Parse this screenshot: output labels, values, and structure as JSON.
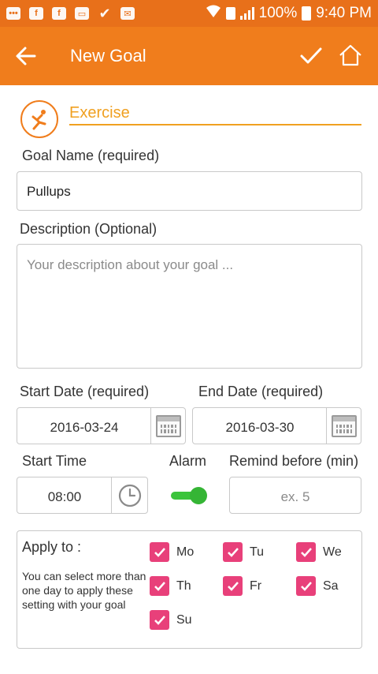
{
  "status_bar": {
    "battery_text": "100%",
    "time": "9:40 PM"
  },
  "app_bar": {
    "title": "New Goal",
    "back_icon": "arrow-left-icon",
    "save_icon": "check-icon",
    "home_icon": "home-icon"
  },
  "category": {
    "name": "Exercise",
    "icon": "stretching-person-icon",
    "accent_color": "#f07d1c"
  },
  "goal_name": {
    "label": "Goal Name (required)",
    "value": "Pullups"
  },
  "description": {
    "label": "Description (Optional)",
    "placeholder": "Your description about your goal ..."
  },
  "start_date": {
    "label": "Start Date (required)",
    "value": "2016-03-24"
  },
  "end_date": {
    "label": "End Date (required)",
    "value": "2016-03-30"
  },
  "start_time": {
    "label": "Start Time",
    "value": "08:00"
  },
  "alarm": {
    "label": "Alarm",
    "enabled": true
  },
  "remind_before": {
    "label": "Remind before (min)",
    "placeholder": "ex. 5"
  },
  "apply_to": {
    "title": "Apply to :",
    "help": "You can select more than one day to apply these setting with your goal",
    "days": [
      {
        "label": "Mo",
        "checked": true
      },
      {
        "label": "Tu",
        "checked": true
      },
      {
        "label": "We",
        "checked": true
      },
      {
        "label": "Th",
        "checked": true
      },
      {
        "label": "Fr",
        "checked": true
      },
      {
        "label": "Sa",
        "checked": true
      },
      {
        "label": "Su",
        "checked": true
      }
    ]
  },
  "colors": {
    "app_bar": "#f07d1c",
    "status_bar": "#e8701a",
    "checkbox": "#e8407a",
    "toggle": "#3cc43c"
  }
}
